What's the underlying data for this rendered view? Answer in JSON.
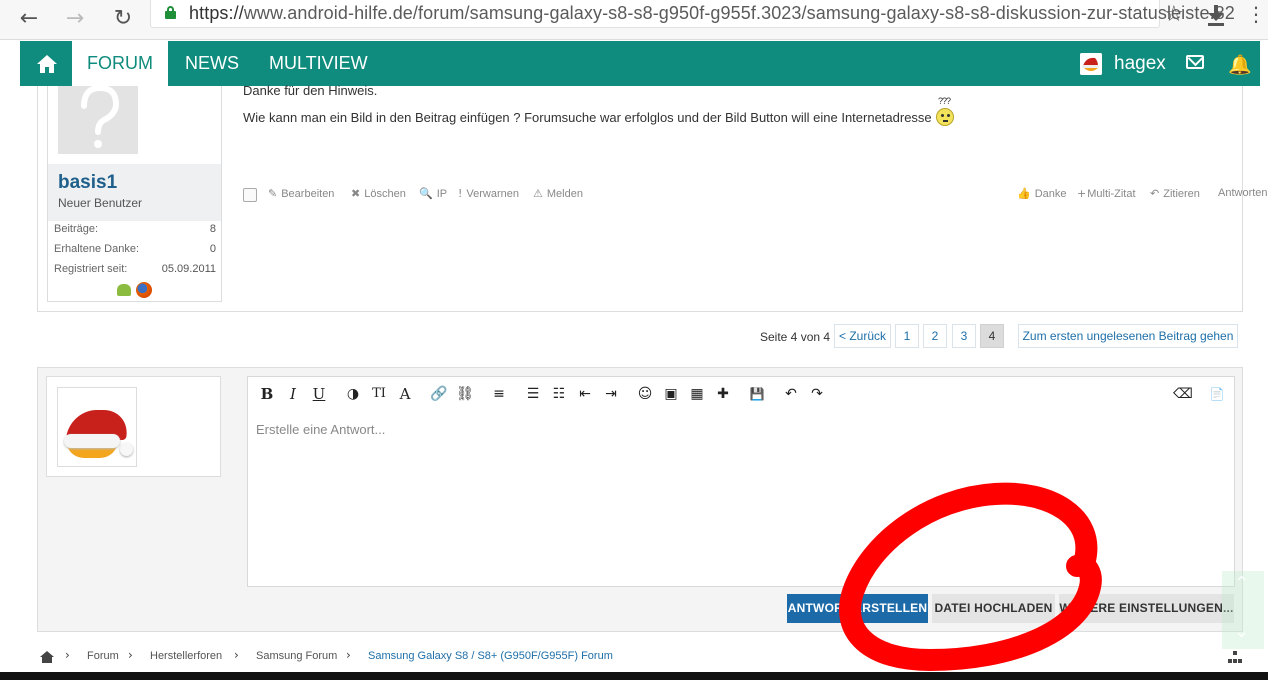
{
  "browser": {
    "url_scheme": "https://",
    "url_rest": "www.android-hilfe.de/forum/samsung-galaxy-s8-s8-g950f-g955f.3023/samsung-galaxy-s8-s8-diskussion-zur-statusleiste.82",
    "back_icon": "←",
    "forward_icon": "→",
    "reload_icon": "↻",
    "star_icon": "☆",
    "menu_icon": "⋮"
  },
  "nav": {
    "tabs": [
      "FORUM",
      "NEWS",
      "MULTIVIEW"
    ],
    "username": "hagex",
    "bell_icon": "🔔",
    "color": "#0f8c7d"
  },
  "post": {
    "author": {
      "name": "basis1",
      "title": "Neuer Benutzer",
      "stats": [
        {
          "label": "Beiträge:",
          "value": "8"
        },
        {
          "label": "Erhaltene Danke:",
          "value": "0"
        },
        {
          "label": "Registriert seit:",
          "value": "05.09.2011"
        }
      ]
    },
    "lines": [
      "Danke für den Hinweis.",
      "Wie kann man ein Bild in den Beitrag einfügen ? Forumsuche war erfolglos und der Bild Button will eine Internetadresse"
    ],
    "smiley_qm": "???",
    "actions_left": [
      {
        "icon": "✎",
        "label": "Bearbeiten"
      },
      {
        "icon": "✖",
        "label": "Löschen"
      },
      {
        "icon": "🔍",
        "label": "IP"
      },
      {
        "icon": "!",
        "label": "Verwarnen"
      },
      {
        "icon": "⚠",
        "label": "Melden"
      }
    ],
    "actions_right": [
      {
        "icon": "👍",
        "label": "Danke"
      },
      {
        "icon": "+",
        "label": "Multi-Zitat"
      },
      {
        "icon": "↶",
        "label": "Zitieren"
      },
      {
        "icon": "",
        "label": "Antworten"
      }
    ]
  },
  "pagination": {
    "label": "Seite 4 von 4",
    "prev": "< Zurück",
    "pages": [
      "1",
      "2",
      "3",
      "4"
    ],
    "current": "4",
    "first_unread": "Zum ersten ungelesenen Beitrag gehen"
  },
  "editor": {
    "placeholder": "Erstelle eine Antwort...",
    "toolbar": [
      {
        "name": "bold-icon",
        "glyph": "B"
      },
      {
        "name": "italic-icon",
        "glyph": "I"
      },
      {
        "name": "underline-icon",
        "glyph": "U"
      },
      {
        "name": "color-icon",
        "glyph": "◑"
      },
      {
        "name": "font-size-icon",
        "glyph": "TI"
      },
      {
        "name": "font-family-icon",
        "glyph": "A"
      },
      {
        "name": "link-icon",
        "glyph": "🔗"
      },
      {
        "name": "unlink-icon",
        "glyph": "⛓"
      },
      {
        "name": "align-icon",
        "glyph": "≡"
      },
      {
        "name": "bullet-list-icon",
        "glyph": "☰"
      },
      {
        "name": "numbered-list-icon",
        "glyph": "☷"
      },
      {
        "name": "outdent-icon",
        "glyph": "⇤"
      },
      {
        "name": "indent-icon",
        "glyph": "⇥"
      },
      {
        "name": "smiley-icon",
        "glyph": "☺"
      },
      {
        "name": "image-icon",
        "glyph": "▣"
      },
      {
        "name": "media-icon",
        "glyph": "▦"
      },
      {
        "name": "insert-icon",
        "glyph": "✚"
      },
      {
        "name": "save-draft-icon",
        "glyph": "💾"
      },
      {
        "name": "undo-icon",
        "glyph": "↶"
      },
      {
        "name": "redo-icon",
        "glyph": "↷"
      },
      {
        "name": "remove-format-icon",
        "glyph": "⌫"
      },
      {
        "name": "toggle-bbcode-icon",
        "glyph": "📄"
      }
    ]
  },
  "reply_buttons": {
    "submit": "ANTWORT ERSTELLEN",
    "upload": "DATEI HOCHLADEN",
    "more": "WEITERE EINSTELLUNGEN..."
  },
  "breadcrumb": [
    "Forum",
    "Herstellerforen",
    "Samsung Forum",
    "Samsung Galaxy S8 / S8+ (G950F/G955F) Forum"
  ],
  "breadcrumb_sep": "›",
  "scroll_up_icon": "⌃",
  "scroll_down_icon": "⌄",
  "colors": {
    "accent": "#0f8c7d",
    "primary_button": "#1c6aa8",
    "link": "#1e6fa8",
    "annotation": "#ff0000"
  }
}
